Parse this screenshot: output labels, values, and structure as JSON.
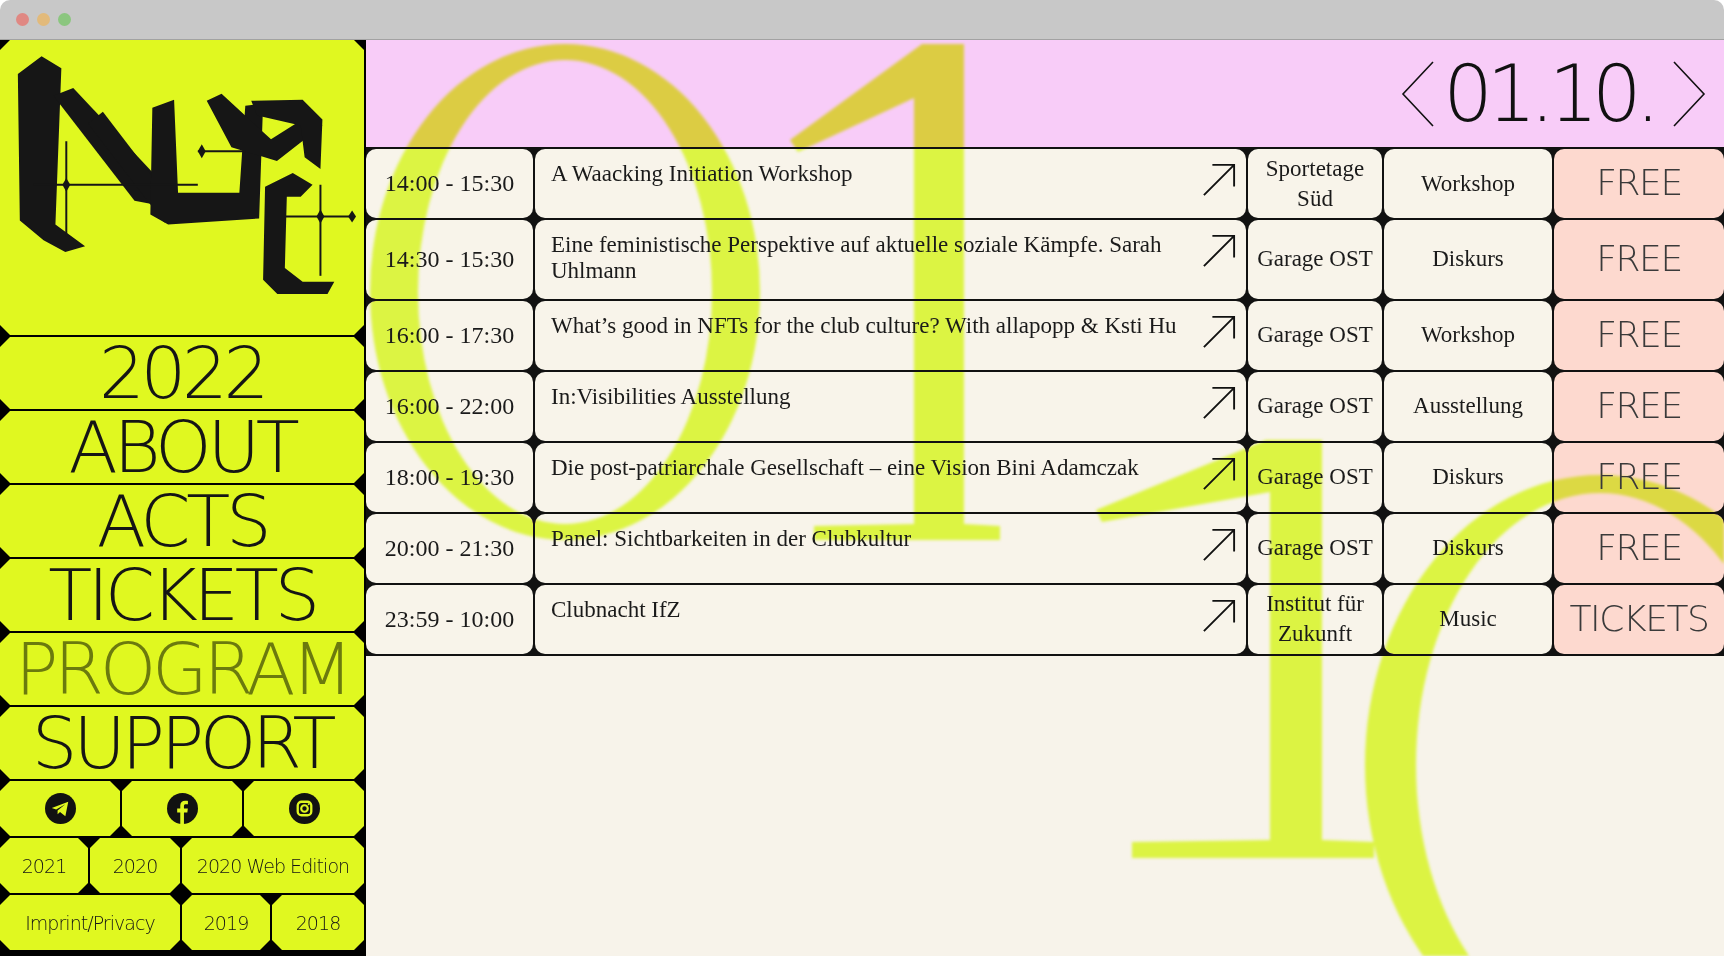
{
  "sidebar": {
    "nav": [
      {
        "label": "2022",
        "selected": false
      },
      {
        "label": "ABOUT",
        "selected": false
      },
      {
        "label": "ACTS",
        "selected": false
      },
      {
        "label": "TICKETS",
        "selected": false
      },
      {
        "label": "PROGRAM",
        "selected": true
      },
      {
        "label": "SUPPORT",
        "selected": false
      }
    ],
    "social_links": [
      {
        "kind": "plane"
      },
      {
        "kind": "f"
      },
      {
        "kind": "camera"
      }
    ],
    "archive_links": [
      [
        "2021",
        "2020",
        "2020 Web Edition"
      ],
      [
        "Imprint/Privacy",
        "2019",
        "2018"
      ]
    ]
  },
  "header": {
    "date": "01.10."
  },
  "events": [
    {
      "time": "14:00 - 15:30",
      "title": "A Waacking Initiation Workshop",
      "location": "Sportetage Süd",
      "category": "Workshop",
      "price": "FREE"
    },
    {
      "time": "14:30 - 15:30",
      "title": "Eine feministische Perspektive auf aktuelle soziale Kämpfe. Sarah Uhlmann",
      "location": "Garage OST",
      "category": "Diskurs",
      "price": "FREE"
    },
    {
      "time": "16:00 - 17:30",
      "title": "What’s good in NFTs for the club culture? With allapopp & Ksti Hu",
      "location": "Garage OST",
      "category": "Workshop",
      "price": "FREE"
    },
    {
      "time": "16:00 - 22:00",
      "title": "In:Visibilities Ausstellung",
      "location": "Garage OST",
      "category": "Ausstellung",
      "price": "FREE"
    },
    {
      "time": "18:00 - 19:30",
      "title": "Die post-patriarchale Gesellschaft – eine Vision Bini Adamczak",
      "location": "Garage OST",
      "category": "Diskurs",
      "price": "FREE"
    },
    {
      "time": "20:00 - 21:30",
      "title": "Panel: Sichtbarkeiten in der Clubkultur",
      "location": "Garage OST",
      "category": "Diskurs",
      "price": "FREE"
    },
    {
      "time": "23:59 - 10:00",
      "title": "Clubnacht IfZ",
      "location": "Institut für Zukunft",
      "category": "Music",
      "price": "TICKETS"
    }
  ]
}
